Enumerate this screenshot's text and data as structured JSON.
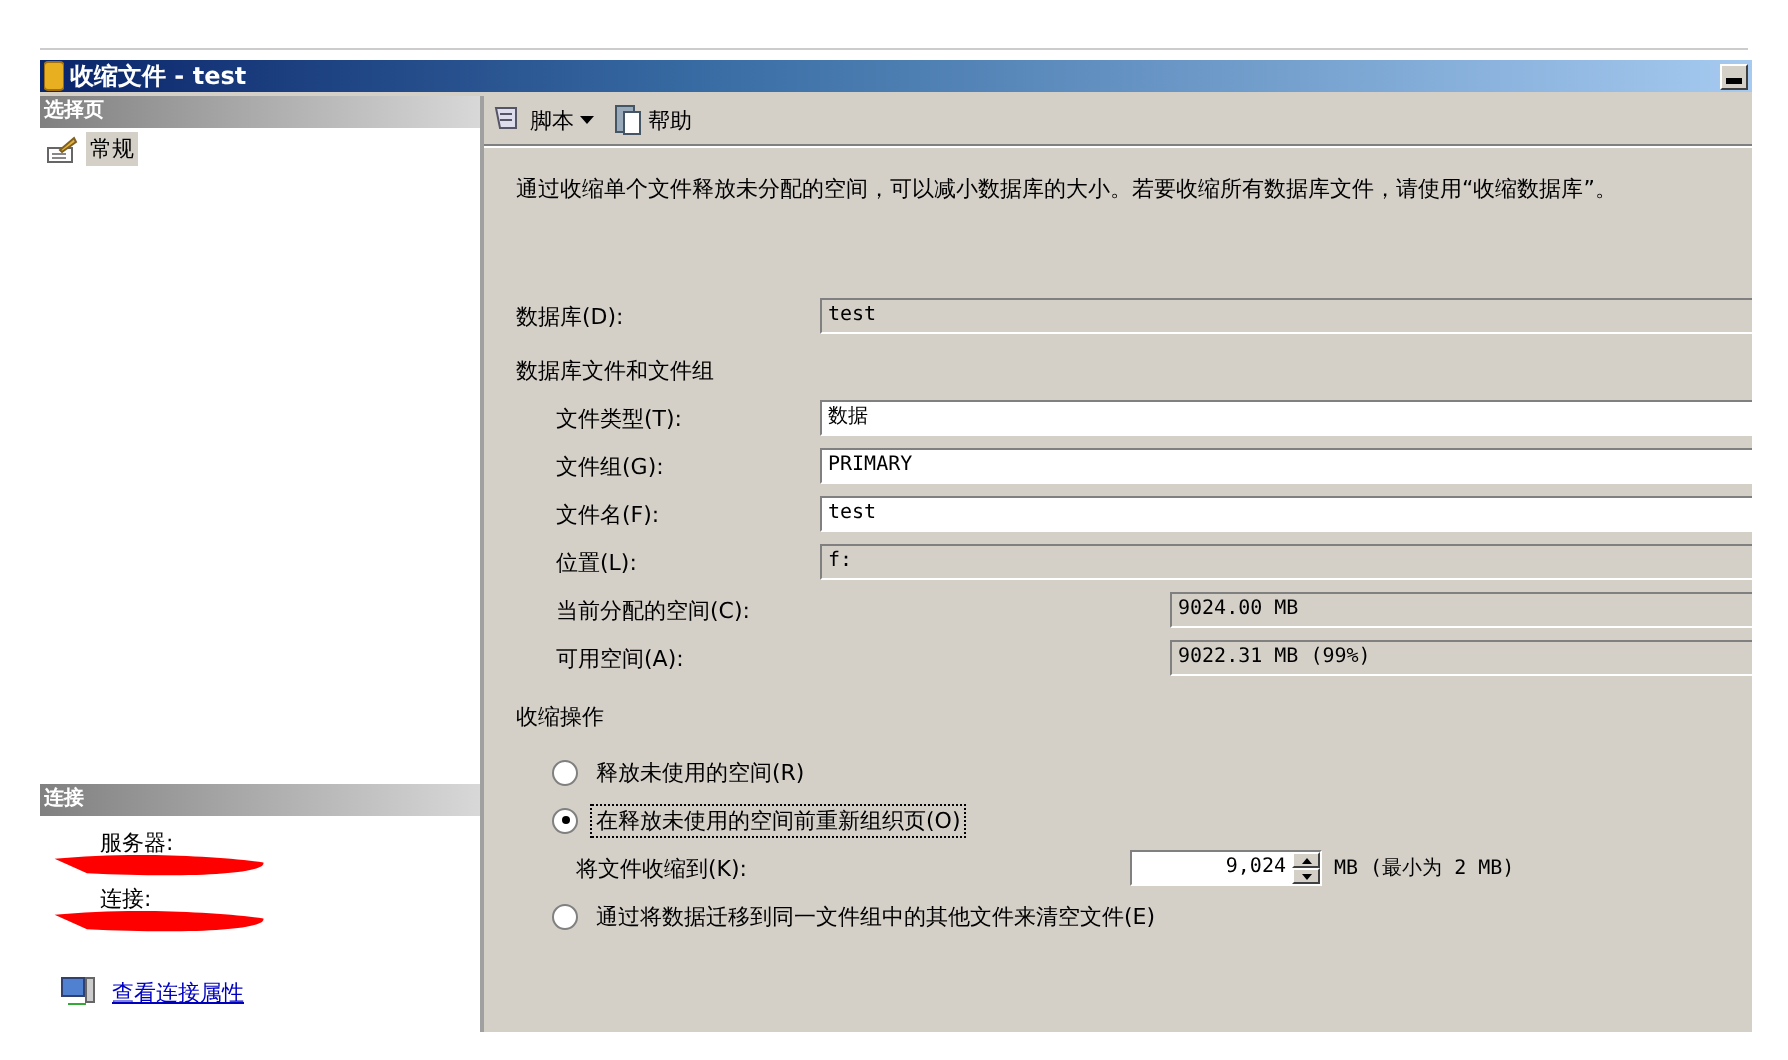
{
  "window": {
    "title": "收缩文件 - test"
  },
  "sidebar": {
    "header": "选择页",
    "items": [
      {
        "label": "常规",
        "selected": true
      }
    ],
    "connection_header": "连接",
    "connection_labels": [
      "服务器:",
      "连接:"
    ],
    "link": "查看连接属性"
  },
  "toolbar": [
    {
      "label": "脚本",
      "kind": "dropdown"
    },
    {
      "label": "帮助",
      "kind": "help"
    }
  ],
  "description": "通过收缩单个文件释放未分配的空间，可以减小数据库的大小。若要收缩所有数据库文件，请使用“收缩数据库”。",
  "database": {
    "label": "数据库(D):",
    "value": "test"
  },
  "files_section": "数据库文件和文件组",
  "file_fields": [
    {
      "label": "文件类型(T):",
      "value": "数据",
      "editable": true
    },
    {
      "label": "文件组(G):",
      "value": "PRIMARY",
      "editable": true
    },
    {
      "label": "文件名(F):",
      "value": "test",
      "editable": true
    },
    {
      "label": "位置(L):",
      "value": "f:",
      "editable": false
    }
  ],
  "space_fields": [
    {
      "label": "当前分配的空间(C):",
      "value": "9024.00 MB"
    },
    {
      "label": "可用空间(A):",
      "value": "9022.31 MB (99%)"
    }
  ],
  "shrink_section": "收缩操作",
  "options": [
    {
      "label": "释放未使用的空间(R)",
      "selected": false,
      "focused": false,
      "kind": "plain"
    },
    {
      "label": "在释放未使用的空间前重新组织页(O)",
      "selected": true,
      "focused": true,
      "kind": "target"
    },
    {
      "label": "通过将数据迁移到同一文件组中的其他文件来清空文件(E)",
      "selected": false,
      "focused": false,
      "kind": "plain"
    }
  ],
  "shrink_to": {
    "label": "将文件收缩到(K):",
    "value": "9,024",
    "unit": "MB (最小为 2 MB)"
  }
}
